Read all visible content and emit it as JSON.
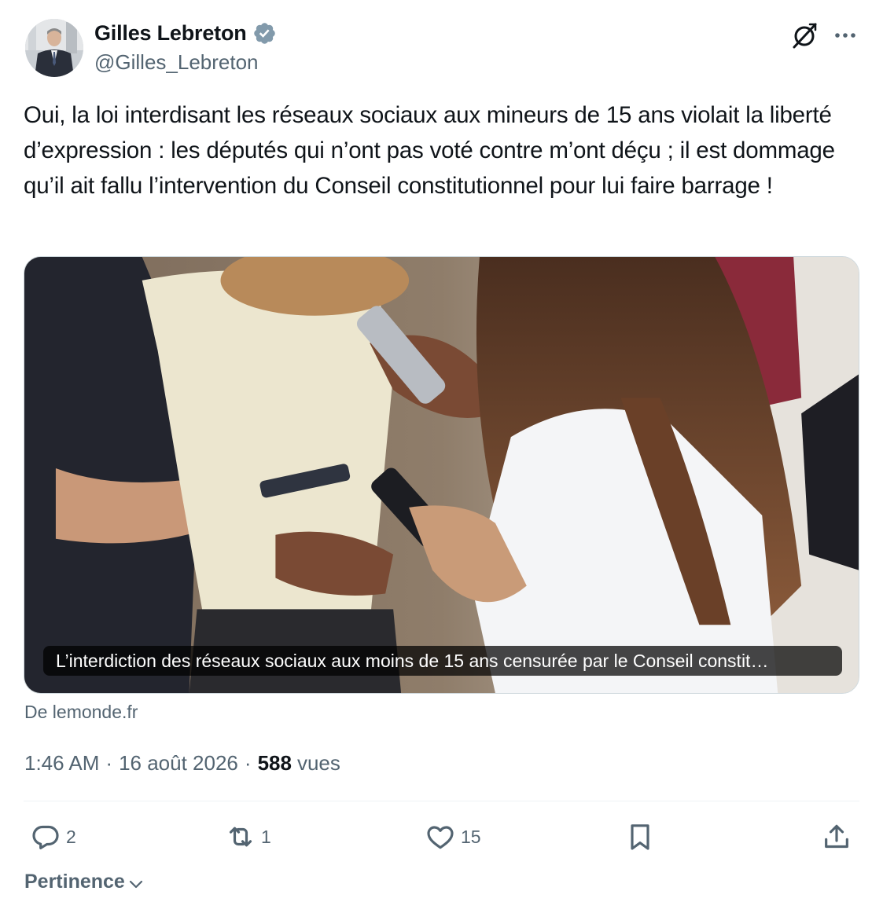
{
  "author": {
    "display_name": "Gilles Lebreton",
    "handle": "@Gilles_Lebreton",
    "verified_icon": "verified-badge-icon"
  },
  "tweet": {
    "text": "Oui, la loi interdisant les réseaux sociaux aux mineurs de 15 ans violait la liberté d’expression : les députés qui n’ont pas voté contre m’ont déçu ; il est dommage qu’il ait fallu l’intervention du Conseil constitutionnel pour lui faire barrage !"
  },
  "link_card": {
    "caption": "L’interdiction des réseaux sociaux aux moins de 15 ans censurée par le Conseil constit…",
    "source": "De lemonde.fr"
  },
  "meta": {
    "time": "1:46 AM",
    "separator": "·",
    "date": "16 août 2026",
    "views_count": "588",
    "views_label": "vues"
  },
  "actions": {
    "replies": "2",
    "reposts": "1",
    "likes": "15",
    "bookmarks": "",
    "share": ""
  },
  "sort": {
    "label": "Pertinence"
  },
  "colors": {
    "text_primary": "#0f1419",
    "text_secondary": "#536471",
    "verified": "#829aab",
    "divider": "#eff3f4"
  }
}
